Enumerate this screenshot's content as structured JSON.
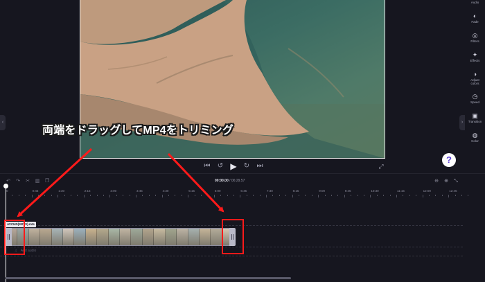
{
  "sidebar": {
    "items": [
      {
        "label": "Audio",
        "icon": "audio-icon"
      },
      {
        "label": "Fade",
        "icon": "fade-icon"
      },
      {
        "label": "Filters",
        "icon": "filters-icon"
      },
      {
        "label": "Effects",
        "icon": "effects-icon"
      },
      {
        "label": "Adjust colors",
        "icon": "adjust-colors-icon"
      },
      {
        "label": "Speed",
        "icon": "speed-icon"
      },
      {
        "label": "Transition",
        "icon": "transition-icon"
      },
      {
        "label": "Color",
        "icon": "color-icon"
      }
    ]
  },
  "player": {
    "help_label": "?"
  },
  "timeline": {
    "timecode_current": "00:00.00",
    "timecode_total": "/ 06:29.57",
    "ruler_labels": [
      "0",
      "0:45",
      "1:30",
      "2:15",
      "3:00",
      "3:45",
      "4:30",
      "5:15",
      "6:00",
      "6:45",
      "7:30",
      "8:15",
      "9:00",
      "9:45",
      "10:30",
      "11:15",
      "12:00",
      "12:45"
    ],
    "clip_name": "AVCHD(M2TS).mts",
    "add_audio_label": "Add audio",
    "thumb_colors": [
      "#b6a79a",
      "#9aa7a3",
      "#c1b29e",
      "#b9a890",
      "#a7b4b6",
      "#d0c6bb",
      "#9bb0bc",
      "#c9b28e",
      "#b4a98c",
      "#a9b7a6",
      "#c0b4a2",
      "#9ea999",
      "#b2a48c",
      "#c7ba9f",
      "#a1a58e",
      "#bcb3a4",
      "#a6b1af",
      "#c5b498",
      "#b3ab99",
      "#d6c8b4"
    ]
  },
  "annotation": {
    "caption": "両端をドラッグしてMP4をトリミング",
    "highlight_color": "#ff1a1a"
  }
}
